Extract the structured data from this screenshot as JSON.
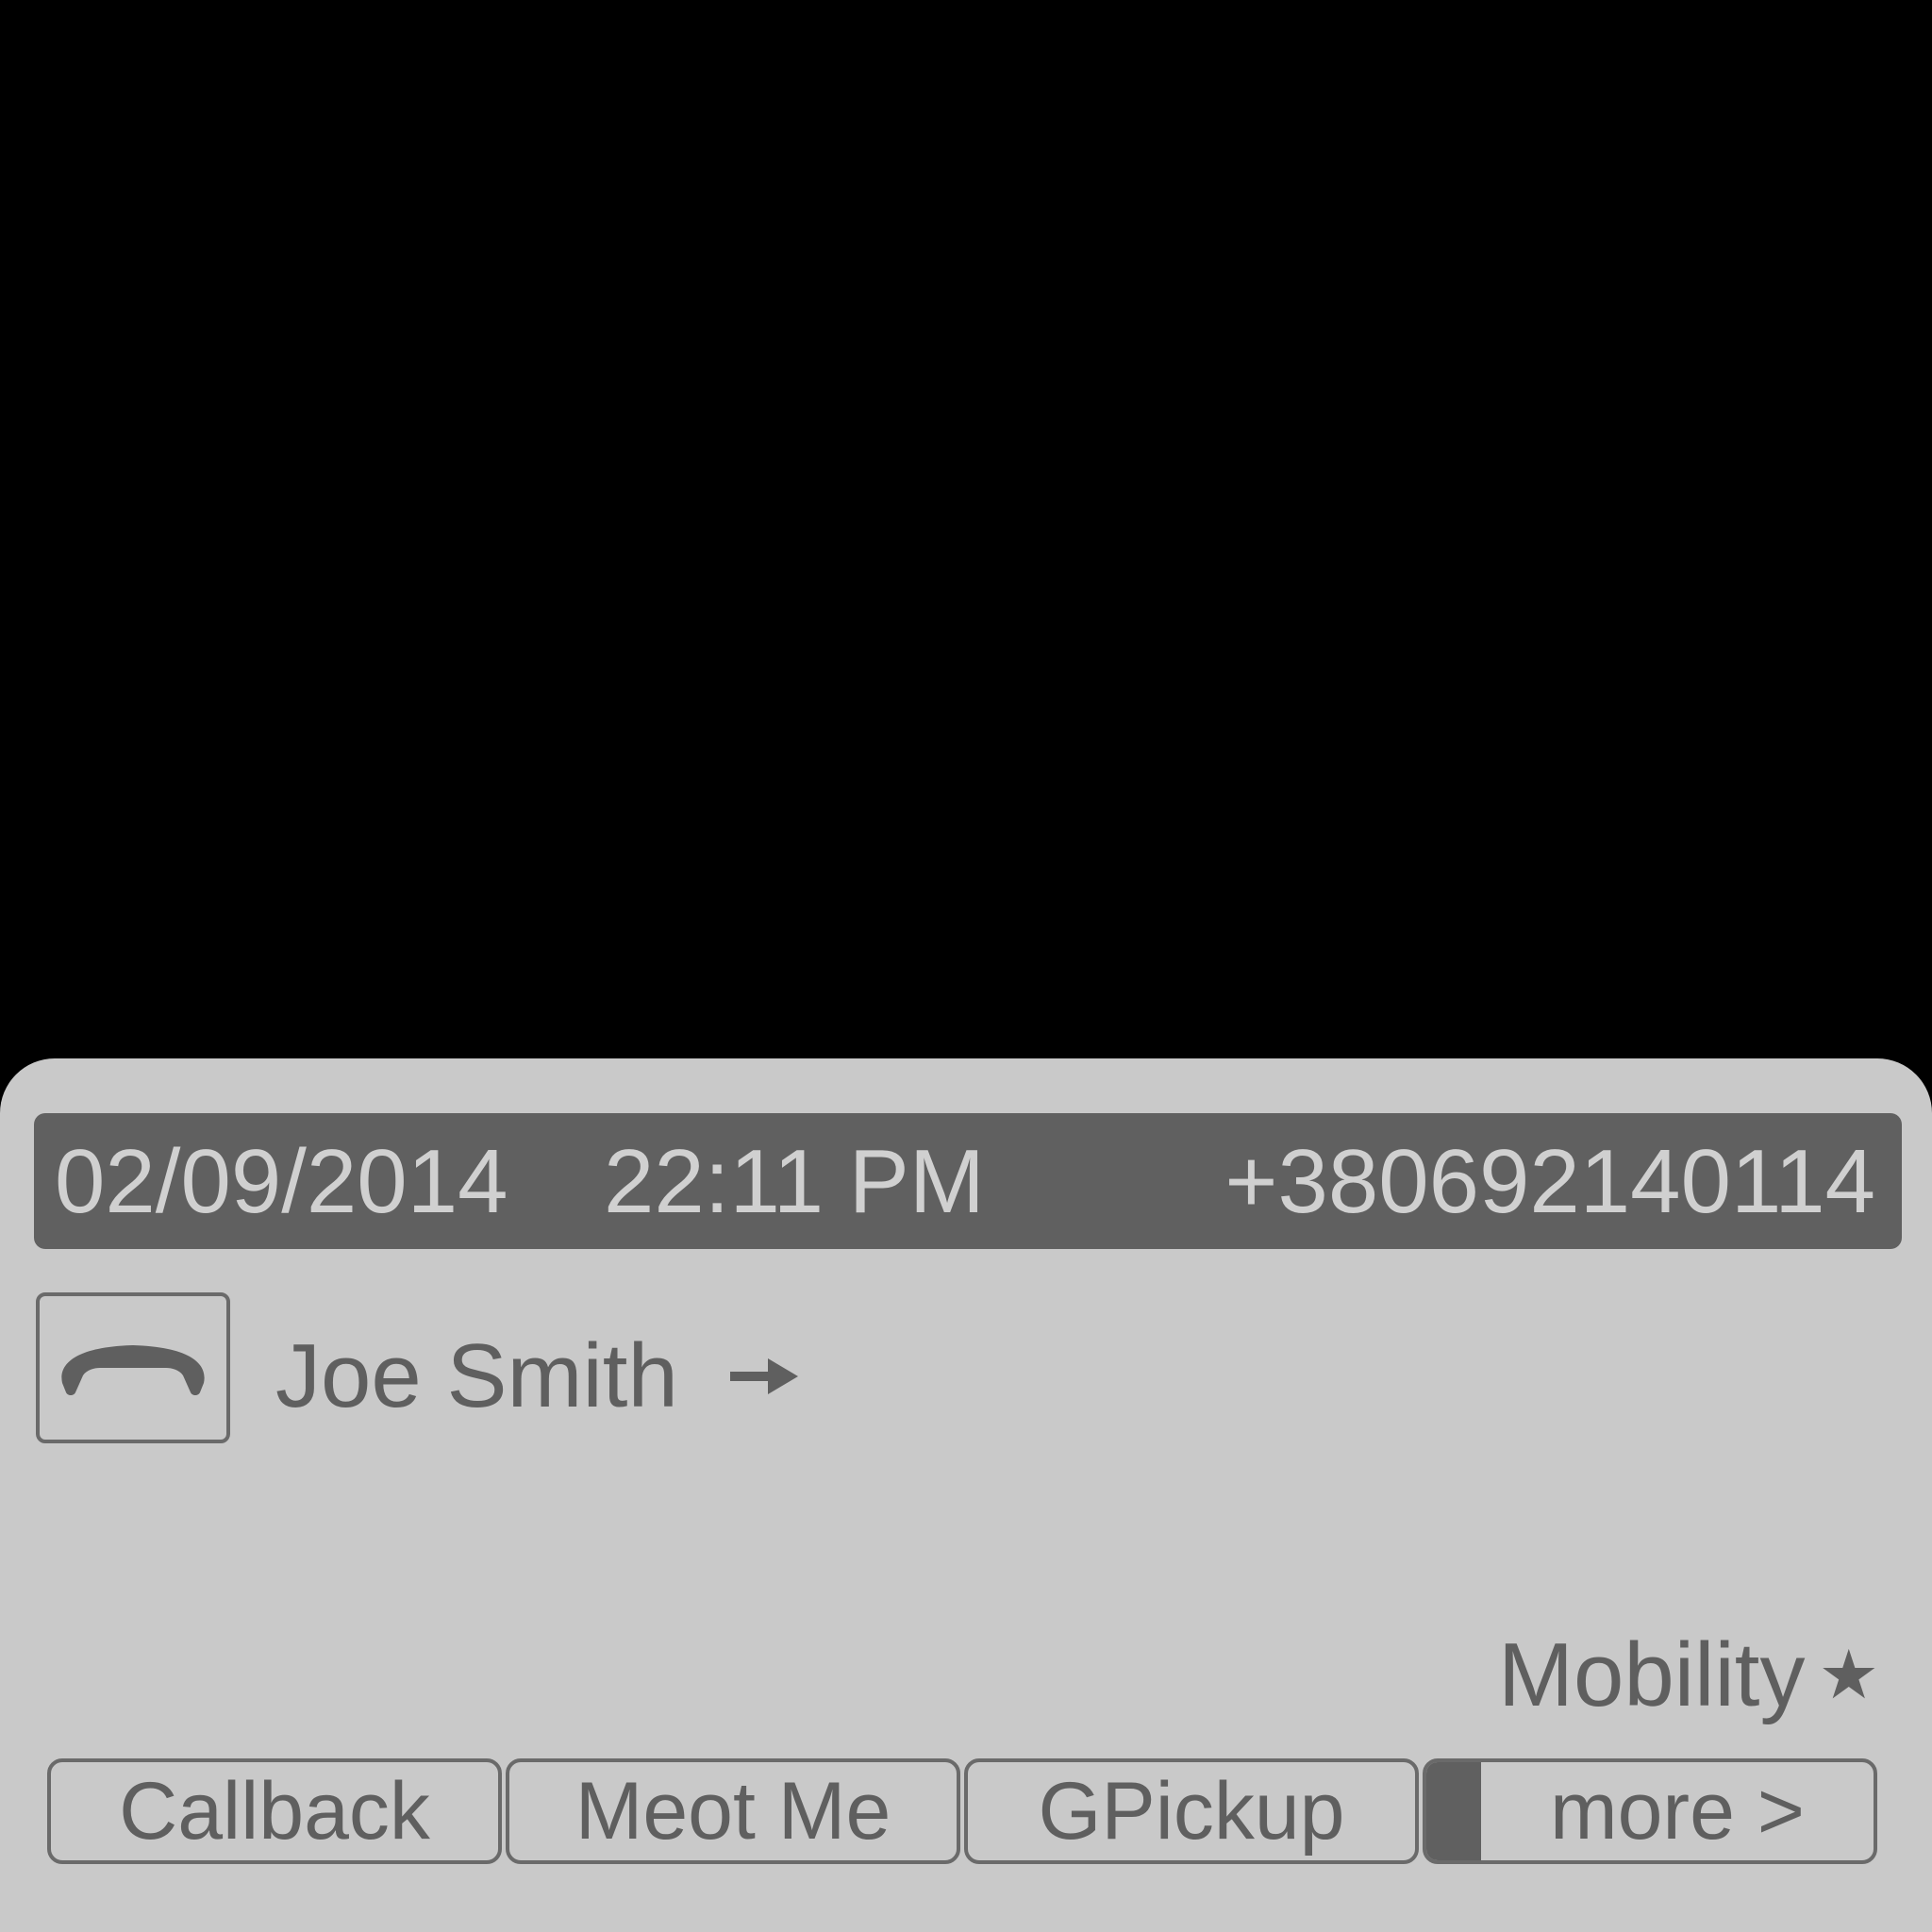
{
  "header": {
    "date": "02/09/2014",
    "time": "22:11 PM",
    "phone_number": "+380692140114"
  },
  "call": {
    "caller_name": "Joe Smith",
    "line_icon": "handset-icon",
    "direction_icon": "arrow-right-icon"
  },
  "status": {
    "label": "Mobility",
    "icon": "star-icon",
    "glyph": "★"
  },
  "softkeys": [
    {
      "label": "Callback"
    },
    {
      "label": "Meot Me"
    },
    {
      "label": "GPickup"
    },
    {
      "label": "more >"
    }
  ],
  "colors": {
    "screen_bg": "#c9c9c9",
    "header_bg": "#606060",
    "header_text": "#d0d0d0",
    "text": "#5f5f5f",
    "outside": "#000000"
  }
}
